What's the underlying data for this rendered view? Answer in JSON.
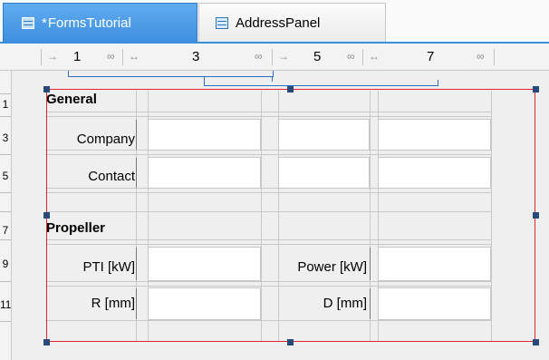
{
  "tabs": [
    {
      "label": "FormsTutorial",
      "modified_marker": "*",
      "active": true,
      "icon": "form-icon"
    },
    {
      "label": "AddressPanel",
      "active": false,
      "icon": "form-icon"
    }
  ],
  "column_ruler": [
    {
      "arrow": "→",
      "number": "1",
      "resize": "∞"
    },
    {
      "arrow": "↔",
      "number": "3",
      "resize": "∞"
    },
    {
      "arrow": "→",
      "number": "5",
      "resize": "∞"
    },
    {
      "arrow": "↔",
      "number": "7",
      "resize": "∞"
    }
  ],
  "row_ruler": [
    "1",
    "3",
    "5",
    "7",
    "9",
    "11"
  ],
  "form": {
    "general": {
      "title": "General",
      "company_label": "Company",
      "contact_label": "Contact"
    },
    "propeller": {
      "title": "Propeller",
      "pti_label": "PTI [kW]",
      "power_label": "Power [kW]",
      "r_label": "R [mm]",
      "d_label": "D [mm]"
    }
  },
  "colors": {
    "tab_active": "#4b9ce6",
    "selection_border": "#e0262a",
    "handle": "#274a7a",
    "grouping_bracket": "#2d6fc4"
  }
}
